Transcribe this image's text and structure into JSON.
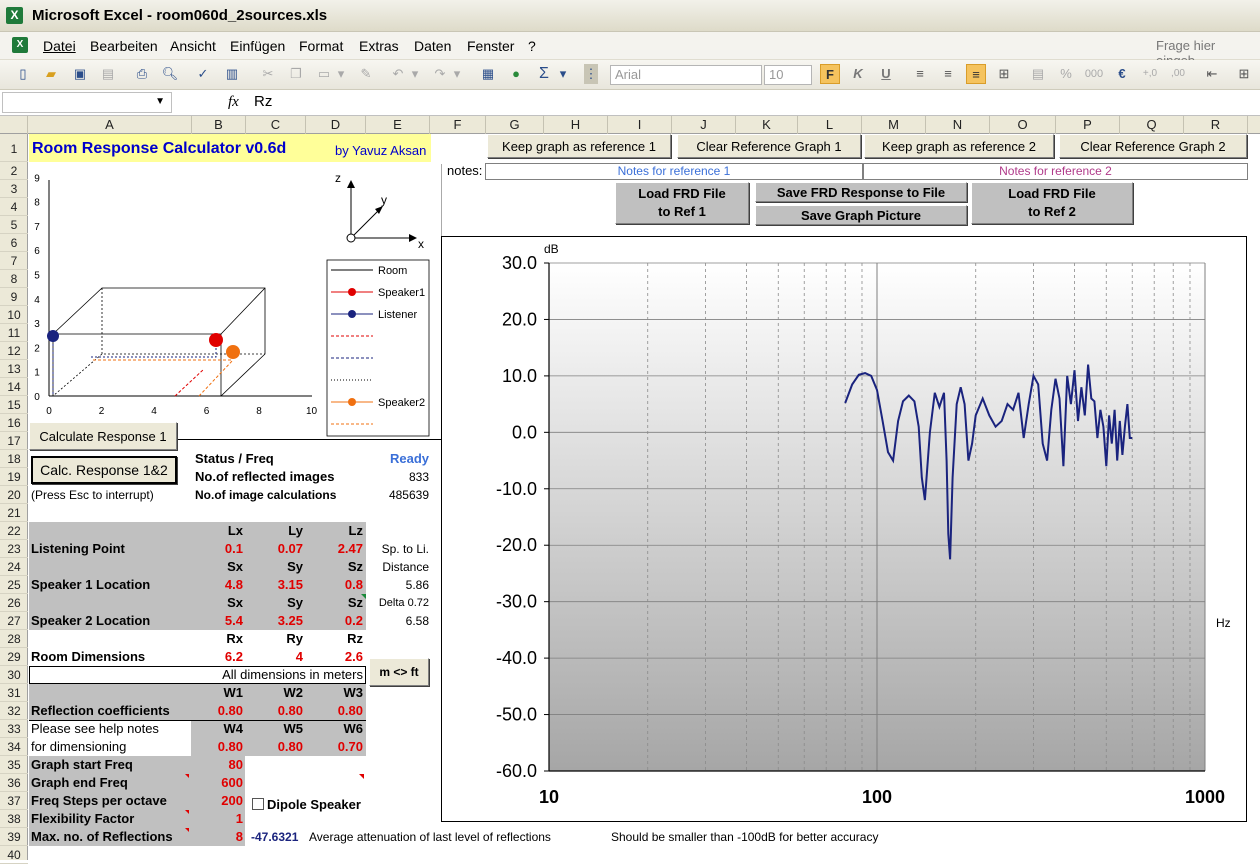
{
  "window": {
    "title": "Microsoft Excel - room060d_2sources.xls",
    "app_icon": "excel-icon"
  },
  "menu": {
    "items": [
      "Datei",
      "Bearbeiten",
      "Ansicht",
      "Einfügen",
      "Format",
      "Extras",
      "Daten",
      "Fenster",
      "?"
    ],
    "help_placeholder": "Frage hier eingeb"
  },
  "toolbar": {
    "font_name": "Arial",
    "font_size": "10",
    "bold_label": "F",
    "italic_label": "K",
    "underline_label": "U",
    "percent_label": "%",
    "thousand_label": "000",
    "euro_label": "€"
  },
  "formula_bar": {
    "name_box": "",
    "fx": "fx",
    "value": "Rz"
  },
  "columns": [
    "A",
    "B",
    "C",
    "D",
    "E",
    "F",
    "G",
    "H",
    "I",
    "J",
    "K",
    "L",
    "M",
    "N",
    "O",
    "P",
    "Q",
    "R"
  ],
  "rows": [
    "1",
    "2",
    "3",
    "4",
    "5",
    "6",
    "7",
    "8",
    "9",
    "10",
    "11",
    "12",
    "13",
    "14",
    "15",
    "16",
    "17",
    "18",
    "19",
    "20",
    "21",
    "22",
    "23",
    "24",
    "25",
    "26",
    "27",
    "28",
    "29",
    "30",
    "31",
    "32",
    "33",
    "34",
    "35",
    "36",
    "37",
    "38",
    "39",
    "40"
  ],
  "sheet": {
    "title": "Room Response Calculator  v0.6d",
    "author": "by Yavuz Aksan",
    "buttons": {
      "keep_ref1": "Keep graph as reference 1",
      "clear_ref1": "Clear Reference Graph 1",
      "keep_ref2": "Keep graph as reference 2",
      "clear_ref2": "Clear Reference Graph 2",
      "load_frd1_l1": "Load FRD File",
      "load_frd1_l2": "to Ref 1",
      "save_frd": "Save FRD Response to File",
      "save_pic": "Save Graph Picture",
      "load_frd2_l1": "Load FRD File",
      "load_frd2_l2": "to Ref 2",
      "calc1": "Calculate Response 1",
      "calc12": "Calc. Response 1&2",
      "mft": "m <> ft"
    },
    "notes_label": "notes:",
    "notes_ref1": "Notes for reference 1",
    "notes_ref2": "Notes for reference 2",
    "status_label": "Status / Freq",
    "status_value": "Ready",
    "reflected_label": "No.of reflected images",
    "reflected_value": "833",
    "calcs_label": "No.of image calculations",
    "calcs_value": "485639",
    "press_esc": "(Press Esc to interrupt)",
    "hdr_lx": "Lx",
    "hdr_ly": "Ly",
    "hdr_lz": "Lz",
    "listening_label": "Listening Point",
    "lx": "0.1",
    "ly": "0.07",
    "lz": "2.47",
    "sp_to_li": "Sp. to Li.",
    "hdr_sx": "Sx",
    "hdr_sy": "Sy",
    "hdr_sz": "Sz",
    "distance_label": "Distance",
    "spk1_label": "Speaker 1 Location",
    "s1x": "4.8",
    "s1y": "3.15",
    "s1z": "0.8",
    "dist1": "5.86",
    "hdr_sx2": "Sx",
    "hdr_sy2": "Sy",
    "hdr_sz2": "Sz",
    "delta": "Delta 0.72",
    "spk2_label": "Speaker 2 Location",
    "s2x": "5.4",
    "s2y": "3.25",
    "s2z": "0.2",
    "dist2": "6.58",
    "hdr_rx": "Rx",
    "hdr_ry": "Ry",
    "hdr_rz": "Rz",
    "room_label": "Room Dimensions",
    "rx": "6.2",
    "ry": "4",
    "rz": "2.6",
    "all_dims": "All dimensions in meters",
    "hdr_w1": "W1",
    "hdr_w2": "W2",
    "hdr_w3": "W3",
    "refl_label": "Reflection coefficients",
    "w1": "0.80",
    "w2": "0.80",
    "w3": "0.80",
    "help_note1": "Please see help notes",
    "help_note2": "for dimensioning",
    "hdr_w4": "W4",
    "hdr_w5": "W5",
    "hdr_w6": "W6",
    "w4": "0.80",
    "w5": "0.80",
    "w6": "0.70",
    "start_freq_label": "Graph start Freq",
    "start_freq": "80",
    "end_freq_label": "Graph end Freq",
    "end_freq": "600",
    "steps_label": "Freq Steps per octave",
    "steps": "200",
    "flex_label": "Flexibility Factor",
    "flex": "1",
    "maxrefl_label": "Max. no. of Reflections",
    "maxrefl": "8",
    "dipole_label": "Dipole Speaker",
    "atten_value": "-47.6321",
    "atten_label": "Average attenuation of last level of reflections",
    "atten_note": "Should be smaller than -100dB for better accuracy"
  },
  "room_plot": {
    "x_ticks": [
      "0",
      "2",
      "4",
      "6",
      "8",
      "10"
    ],
    "y_ticks": [
      "0",
      "1",
      "2",
      "3",
      "4",
      "5",
      "6",
      "7",
      "8",
      "9"
    ],
    "axis_z": "z",
    "axis_y": "y",
    "axis_x": "x",
    "legend": [
      {
        "label": "Room",
        "color": "#000000",
        "style": "solid",
        "marker": false
      },
      {
        "label": "Speaker1",
        "color": "#e00000",
        "style": "solid",
        "marker": true
      },
      {
        "label": "Listener",
        "color": "#1a237e",
        "style": "solid",
        "marker": true
      },
      {
        "label": "",
        "color": "#e00000",
        "style": "dashed",
        "marker": false
      },
      {
        "label": "",
        "color": "#1a237e",
        "style": "dashed",
        "marker": false
      },
      {
        "label": "",
        "color": "#000000",
        "style": "dotted",
        "marker": false
      },
      {
        "label": "Speaker2",
        "color": "#f07010",
        "style": "solid",
        "marker": true
      },
      {
        "label": "",
        "color": "#f07010",
        "style": "dashed",
        "marker": false
      }
    ]
  },
  "chart_data": {
    "type": "line",
    "title": "",
    "xlabel": "Hz",
    "ylabel": "dB",
    "x_scale": "log",
    "xlim": [
      10,
      1000
    ],
    "ylim": [
      -60,
      30
    ],
    "y_ticks": [
      "30.0",
      "20.0",
      "10.0",
      "0.0",
      "-10.0",
      "-20.0",
      "-30.0",
      "-40.0",
      "-50.0",
      "-60.0"
    ],
    "x_ticks": [
      "10",
      "100",
      "1000"
    ],
    "grid": true,
    "line_color": "#1a237e",
    "series": [
      {
        "x": [
          80,
          84,
          88,
          92,
          96,
          100,
          104,
          108,
          112,
          116,
          120,
          125,
          130,
          134,
          137,
          140,
          145,
          150,
          155,
          160,
          163,
          165,
          167,
          170,
          175,
          180,
          185,
          190,
          195,
          200,
          210,
          220,
          230,
          240,
          250,
          260,
          270,
          280,
          290,
          300,
          310,
          320,
          330,
          340,
          350,
          360,
          370,
          380,
          390,
          400,
          410,
          420,
          430,
          440,
          450,
          460,
          470,
          480,
          490,
          500,
          510,
          520,
          530,
          540,
          550,
          560,
          570,
          580,
          590,
          600
        ],
        "y": [
          5.2,
          8.5,
          10.2,
          10.5,
          10.0,
          7.5,
          2.0,
          -3.5,
          -5.0,
          2.0,
          5.5,
          6.5,
          5.5,
          1.0,
          -8.0,
          -12.0,
          0.0,
          7.0,
          4.5,
          7.0,
          -5.0,
          -18.0,
          -22.5,
          -8.0,
          5.0,
          8.0,
          5.0,
          -5.0,
          -2.0,
          3.0,
          6.0,
          3.0,
          1.0,
          2.0,
          5.0,
          4.0,
          7.0,
          -1.0,
          5.0,
          10.0,
          8.5,
          -2.0,
          -5.0,
          4.0,
          9.5,
          6.0,
          -6.0,
          10.0,
          5.0,
          11.0,
          2.0,
          8.0,
          3.0,
          12.0,
          6.0,
          5.5,
          -1.0,
          4.0,
          1.0,
          -6.0,
          3.0,
          -2.0,
          4.0,
          -5.0,
          2.0,
          -4.0,
          1.0,
          5.0,
          -1.0,
          -1.0
        ]
      }
    ]
  }
}
